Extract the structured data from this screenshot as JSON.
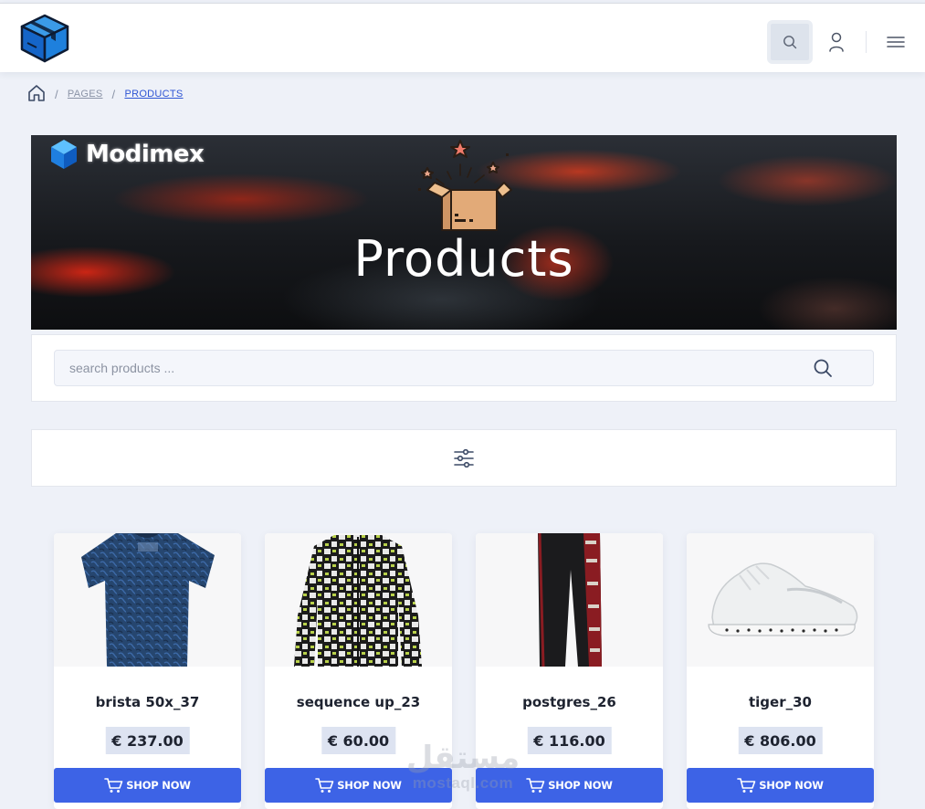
{
  "header": {
    "logo_icon": "cube-box-icon",
    "search_icon": "search-icon",
    "user_icon": "user-icon",
    "menu_icon": "hamburger-menu-icon"
  },
  "breadcrumb": {
    "home_icon": "home-icon",
    "separator": "/",
    "items": [
      {
        "label": "PAGES"
      },
      {
        "label": "PRODUCTS"
      }
    ]
  },
  "banner": {
    "brand_name": "Modimex",
    "title": "Products",
    "brand_icon": "hexagon-cube-icon",
    "illustration_icon": "open-gift-box-icon"
  },
  "search": {
    "placeholder": "search products ...",
    "value": "",
    "icon": "search-icon"
  },
  "filter": {
    "icon": "sliders-filter-icon"
  },
  "products": [
    {
      "name": "brista 50x_37",
      "price": "€ 237.00",
      "button_label": "SHOP NOW",
      "image": "blue-patterned-tshirt"
    },
    {
      "name": "sequence up_23",
      "price": "€ 60.00",
      "button_label": "SHOP NOW",
      "image": "hh-print-jacket"
    },
    {
      "name": "postgres_26",
      "price": "€ 116.00",
      "button_label": "SHOP NOW",
      "image": "black-track-pants"
    },
    {
      "name": "tiger_30",
      "price": "€ 806.00",
      "button_label": "SHOP NOW",
      "image": "white-sneaker"
    }
  ],
  "watermark": {
    "arabic": "مستقل",
    "latin": "mostaql.com"
  },
  "colors": {
    "accent": "#3d63e6",
    "page_bg": "#eef1f8",
    "price_bg": "#dde3f1",
    "link": "#2f55d4"
  }
}
